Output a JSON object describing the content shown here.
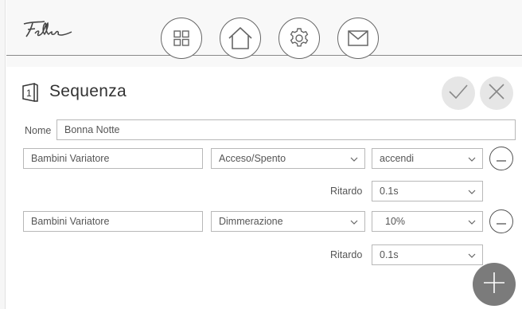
{
  "header": {
    "logo_text": "Feller",
    "nav": [
      {
        "icon": "grid-icon"
      },
      {
        "icon": "home-icon"
      },
      {
        "icon": "gear-icon"
      },
      {
        "icon": "mail-icon"
      }
    ]
  },
  "page": {
    "title": "Sequenza",
    "title_icon": "scene-number-icon",
    "title_icon_number": "1",
    "confirm_icon": "checkmark-icon",
    "cancel_icon": "close-icon"
  },
  "form": {
    "name_label": "Nome",
    "name_value": "Bonna Notte",
    "rows": [
      {
        "device": "Bambini Variatore",
        "function": "Acceso/Spento",
        "value": "accendi",
        "delay_label": "Ritardo",
        "delay": "0.1s"
      },
      {
        "device": "Bambini Variatore",
        "function": "Dimmerazione",
        "value": "10%",
        "delay_label": "Ritardo",
        "delay": "0.1s"
      }
    ],
    "add_icon": "plus-icon",
    "remove_icon": "minus-icon"
  },
  "colors": {
    "header_bg": "#f8f8f8",
    "outline": "#666666",
    "circle_bg": "#e6e6e6",
    "fab_bg": "#7b7b7b",
    "border": "#b8b8b8"
  }
}
